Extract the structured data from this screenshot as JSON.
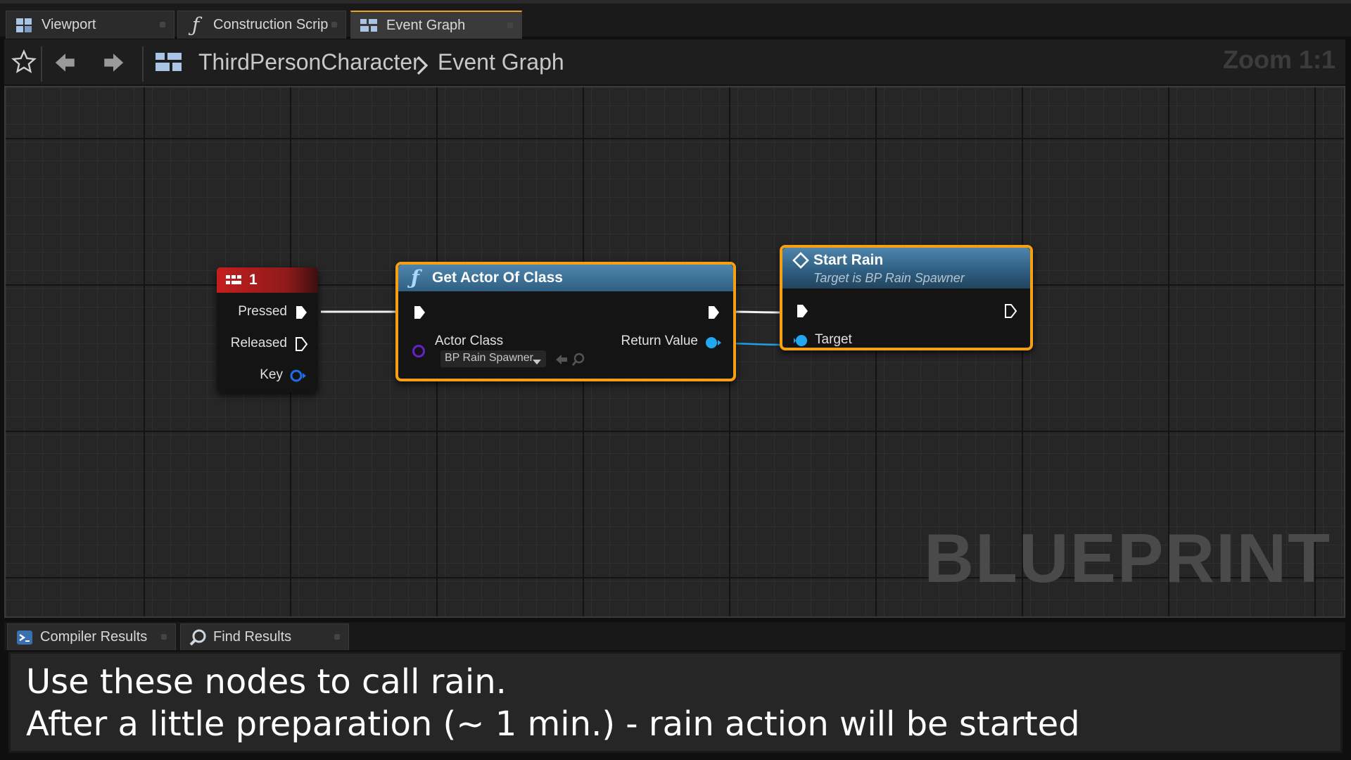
{
  "tabs": [
    {
      "label": "Viewport",
      "icon": "viewport-icon"
    },
    {
      "label": "Construction Scrip",
      "icon": "function-icon"
    },
    {
      "label": "Event Graph",
      "icon": "graph-icon",
      "active": true
    }
  ],
  "toolbar": {
    "breadcrumb": [
      "ThirdPersonCharacter",
      "Event Graph"
    ],
    "zoom": "Zoom 1:1"
  },
  "watermark": "BLUEPRINT",
  "nodes": {
    "key_event": {
      "title": "1",
      "pins": {
        "pressed": "Pressed",
        "released": "Released",
        "key": "Key"
      }
    },
    "get_actor": {
      "title": "Get Actor Of Class",
      "actor_class_label": "Actor Class",
      "actor_class_value": "BP Rain Spawner",
      "return_value_label": "Return Value"
    },
    "start_rain": {
      "title": "Start Rain",
      "subtitle": "Target is BP Rain Spawner",
      "target_label": "Target"
    }
  },
  "bottom_tabs": [
    {
      "label": "Compiler Results",
      "icon": "compiler-icon"
    },
    {
      "label": "Find Results",
      "icon": "find-icon"
    }
  ],
  "caption": {
    "line1": "Use these nodes to call rain.",
    "line2": "After a little preparation (~ 1 min.) - rain action will be started"
  },
  "colors": {
    "accent": "#f5a014",
    "event_header": "#a81a1a",
    "function_header": "#3f6f92",
    "object_pin": "#22a8f0",
    "class_pin": "#6a1fc8"
  }
}
